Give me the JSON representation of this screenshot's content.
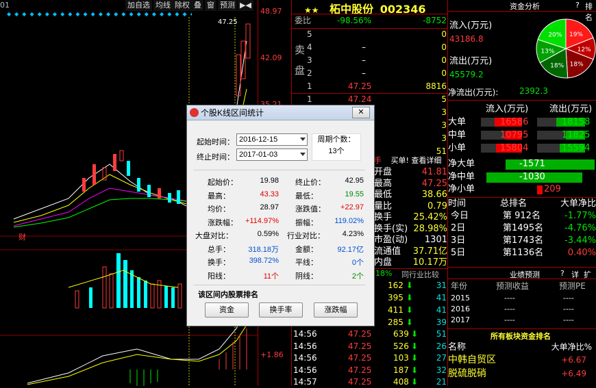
{
  "toolbar": {
    "left_text": "01",
    "buttons": [
      "加自选",
      "均线",
      "除权",
      "叠",
      "窗",
      "预测"
    ]
  },
  "chart": {
    "price_high": "48.97",
    "price_mid": "42.09",
    "price_low": "35.21",
    "peak_label": "47.25",
    "marker_cai": "财",
    "macd_label": "+1.86"
  },
  "title": {
    "stars": "★★",
    "name": "柘中股份",
    "code": "002346"
  },
  "order_book": {
    "webi_label": "委比",
    "webi_pct": "-98.56%",
    "webi_val": "-8752",
    "sell_label": "卖",
    "pan_label": "盘",
    "sells": [
      {
        "lv": "5",
        "p": "",
        "v": "0"
      },
      {
        "lv": "4",
        "p": "–",
        "v": "0"
      },
      {
        "lv": "3",
        "p": "–",
        "v": "0"
      },
      {
        "lv": "2",
        "p": "–",
        "v": "0"
      },
      {
        "lv": "1",
        "p": "47.25",
        "v": "8816"
      }
    ],
    "buy1": {
      "lv": "1",
      "p": "47.24",
      "v": "5"
    }
  },
  "quote": {
    "tabs": {
      "hand": "手",
      "buy": "买单!",
      "detail": "查看详细"
    },
    "rows": [
      {
        "k": "开盘",
        "v": "41.81",
        "c": "red"
      },
      {
        "k": "最高",
        "v": "47.25",
        "c": "red"
      },
      {
        "k": "最低",
        "v": "38.66",
        "c": "yel"
      },
      {
        "k": "量比",
        "v": "0.79",
        "c": "yel"
      },
      {
        "k": "换手",
        "v": "25.42%",
        "c": "yel"
      },
      {
        "k": "换手(实)",
        "v": "28.98%",
        "c": "yel"
      },
      {
        "k": "市盈(动)",
        "v": "1301",
        "c": "wht"
      },
      {
        "k": "流通值",
        "v": "37.71亿",
        "c": "yel"
      },
      {
        "k": "内盘",
        "v": "10.17万",
        "c": "yel"
      }
    ],
    "bottom_tab": "同行业比较",
    "bottom_pct": "18%"
  },
  "ticks": {
    "upper": [
      {
        "v": "162",
        "n": "31"
      },
      {
        "v": "395",
        "n": "41"
      },
      {
        "v": "411",
        "n": "41"
      },
      {
        "v": "285",
        "n": "39"
      }
    ],
    "rows": [
      {
        "t": "14:56",
        "p": "47.25",
        "v": "639",
        "n": "51"
      },
      {
        "t": "14:56",
        "p": "47.25",
        "v": "526",
        "n": "26"
      },
      {
        "t": "14:56",
        "p": "47.25",
        "v": "103",
        "n": "27"
      },
      {
        "t": "14:56",
        "p": "47.25",
        "v": "187",
        "n": "32"
      },
      {
        "t": "14:57",
        "p": "47.25",
        "v": "408",
        "n": "21"
      }
    ]
  },
  "fund": {
    "header": "资金分析",
    "q": "?",
    "rank": "排名",
    "inflow_label": "流入(万元)",
    "inflow": "43186.8",
    "outflow_label": "流出(万元)",
    "outflow": "45579.2",
    "net_label": "净流出(万元):",
    "net": "2392.3",
    "pie": [
      {
        "label": "19%",
        "color": "#ff1a1a"
      },
      {
        "label": "12%",
        "color": "#c00000"
      },
      {
        "label": "18%",
        "color": "#8a0000"
      },
      {
        "label": "18%",
        "color": "#006600"
      },
      {
        "label": "13%",
        "color": "#00a000"
      },
      {
        "label": "20%",
        "color": "#00e000"
      }
    ],
    "col_in": "流入(万元)",
    "col_out": "流出(万元)",
    "orders": [
      {
        "k": "大单",
        "in": "16586",
        "out": "18158"
      },
      {
        "k": "中单",
        "in": "10795",
        "out": "11825"
      },
      {
        "k": "小单",
        "in": "15804",
        "out": "15594"
      }
    ],
    "nets": [
      {
        "k": "净大单",
        "v": "-1571"
      },
      {
        "k": "净中单",
        "v": "-1030"
      },
      {
        "k": "净小单",
        "v": "209"
      }
    ],
    "rank_head": {
      "t": "时间",
      "r": "总排名",
      "n": "大单净比"
    },
    "ranks": [
      {
        "t": "今日",
        "r": "第 912名",
        "n": "-1.77%",
        "c": "grn"
      },
      {
        "t": "2日",
        "r": "第1495名",
        "n": "-4.76%",
        "c": "grn"
      },
      {
        "t": "3日",
        "r": "第1743名",
        "n": "-3.44%",
        "c": "grn"
      },
      {
        "t": "5日",
        "r": "第1136名",
        "n": "0.40%",
        "c": "red"
      }
    ]
  },
  "forecast": {
    "title": "业绩预测",
    "q": "?",
    "detail": "详",
    "ext": "扩",
    "head": {
      "y": "年份",
      "e": "预测收益",
      "p": "预测PE"
    },
    "rows": [
      {
        "y": "2015",
        "e": "----",
        "p": "----"
      },
      {
        "y": "2016",
        "e": "----",
        "p": "----"
      },
      {
        "y": "2017",
        "e": "----",
        "p": "----"
      }
    ]
  },
  "sector": {
    "title": "所有板块资金排名",
    "col_name": "名称",
    "col_val": "大单净比%",
    "rows": [
      {
        "n": "中韩自贸区",
        "v": "+6.67"
      },
      {
        "n": "脱硫脱硝",
        "v": "+6.49"
      }
    ]
  },
  "dialog": {
    "title": "个股K线区间统计",
    "close": "✕",
    "start_label": "起始时间：",
    "start_date": "2016-12-15",
    "end_label": "终止时间：",
    "end_date": "2017-01-03",
    "period_label": "周期个数：",
    "period_val": "13个",
    "stats": [
      {
        "l": "起始价：",
        "v": "19.98",
        "c": "",
        "l2": "终止价：",
        "v2": "42.95",
        "c2": ""
      },
      {
        "l": "最高：",
        "v": "43.33",
        "c": "d-red",
        "l2": "最低：",
        "v2": "19.55",
        "c2": "d-grn"
      },
      {
        "l": "均价：",
        "v": "28.97",
        "c": "",
        "l2": "涨跌值：",
        "v2": "+22.97",
        "c2": "d-red"
      },
      {
        "l": "涨跌幅：",
        "v": "+114.97%",
        "c": "d-red",
        "l2": "振幅：",
        "v2": "119.02%",
        "c2": "d-blu"
      },
      {
        "l": "大盘对比：",
        "v": "0.59%",
        "c": "",
        "l2": "行业对比：",
        "v2": "4.23%",
        "c2": ""
      },
      {
        "l": "总手：",
        "v": "318.18万",
        "c": "d-blu",
        "l2": "金额：",
        "v2": "92.17亿",
        "c2": "d-blu"
      },
      {
        "l": "换手：",
        "v": "398.72%",
        "c": "d-blu",
        "l2": "平线：",
        "v2": "0个",
        "c2": "d-blu"
      },
      {
        "l": "阳线：",
        "v": "11个",
        "c": "d-red",
        "l2": "阴线：",
        "v2": "2个",
        "c2": "d-grn"
      }
    ],
    "rank_title": "该区间内股票排名",
    "btns": [
      "资金",
      "换手率",
      "涨跌幅"
    ]
  }
}
